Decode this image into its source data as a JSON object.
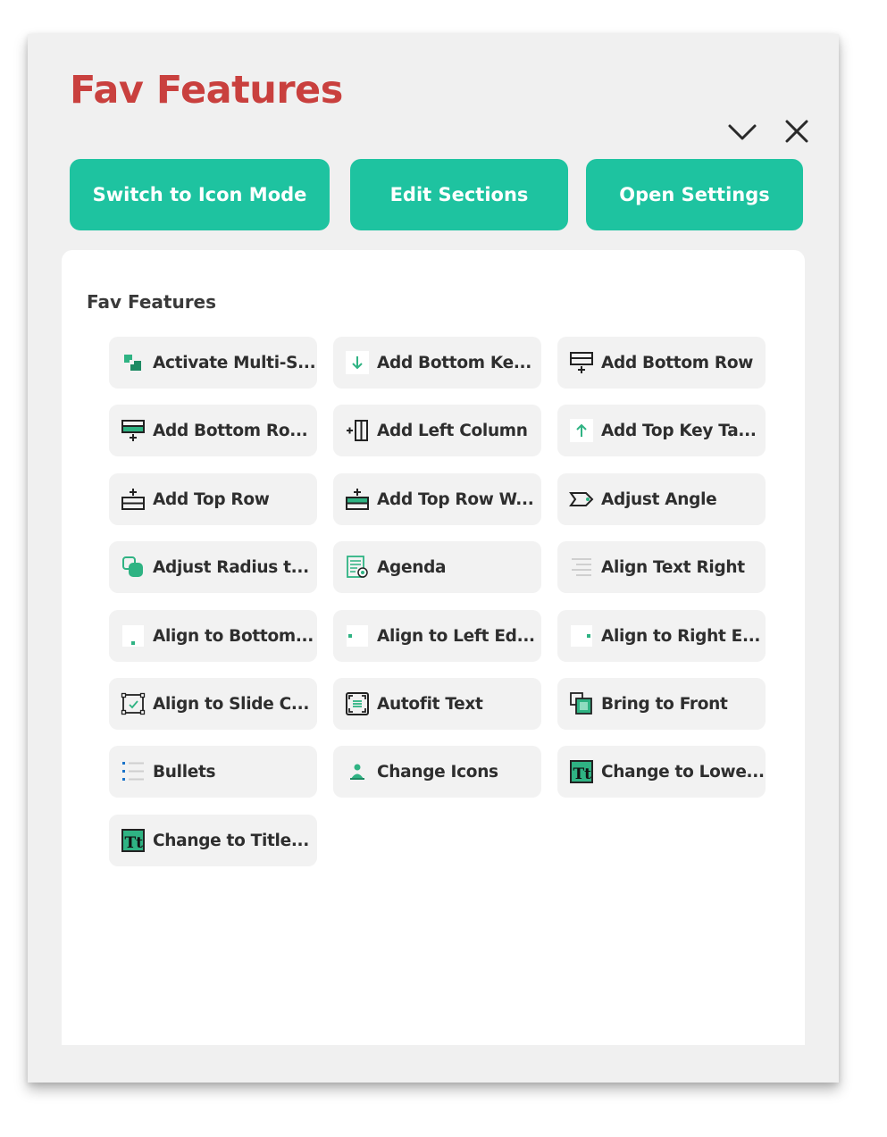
{
  "header": {
    "title": "Fav Features",
    "collapse_icon": "chevron-down-icon",
    "close_icon": "close-icon"
  },
  "actions": {
    "switch_mode": "Switch to Icon Mode",
    "edit_sections": "Edit Sections",
    "open_settings": "Open Settings"
  },
  "colors": {
    "title": "#c9403e",
    "accent": "#1ec3a0",
    "panel_bg": "#f0f0f0",
    "tile_bg": "#f2f2f2",
    "icon_green": "#2fb383"
  },
  "section": {
    "title": "Fav Features",
    "features": [
      {
        "label": "Activate Multi-S...",
        "icon": "multi-select-icon"
      },
      {
        "label": "Add Bottom Ke...",
        "icon": "arrow-down-icon"
      },
      {
        "label": "Add Bottom Row",
        "icon": "add-bottom-row-icon"
      },
      {
        "label": "Add Bottom Ro...",
        "icon": "add-bottom-row-fill-icon"
      },
      {
        "label": "Add Left Column",
        "icon": "add-left-column-icon"
      },
      {
        "label": "Add Top Key Ta...",
        "icon": "arrow-up-icon"
      },
      {
        "label": "Add Top Row",
        "icon": "add-top-row-icon"
      },
      {
        "label": "Add Top Row W...",
        "icon": "add-top-row-fill-icon"
      },
      {
        "label": "Adjust Angle",
        "icon": "adjust-angle-icon"
      },
      {
        "label": "Adjust Radius t...",
        "icon": "adjust-radius-icon"
      },
      {
        "label": "Agenda",
        "icon": "agenda-icon"
      },
      {
        "label": "Align Text Right",
        "icon": "align-text-right-icon"
      },
      {
        "label": "Align to Bottom...",
        "icon": "align-bottom-icon"
      },
      {
        "label": "Align to Left Ed...",
        "icon": "align-left-edge-icon"
      },
      {
        "label": "Align to Right E...",
        "icon": "align-right-edge-icon"
      },
      {
        "label": "Align to Slide C...",
        "icon": "align-slide-center-icon"
      },
      {
        "label": "Autofit Text",
        "icon": "autofit-text-icon"
      },
      {
        "label": "Bring to Front",
        "icon": "bring-to-front-icon"
      },
      {
        "label": "Bullets",
        "icon": "bullets-icon"
      },
      {
        "label": "Change Icons",
        "icon": "change-icons-icon"
      },
      {
        "label": "Change to Lowe...",
        "icon": "change-case-icon"
      },
      {
        "label": "Change to Title...",
        "icon": "change-case-icon"
      }
    ]
  }
}
